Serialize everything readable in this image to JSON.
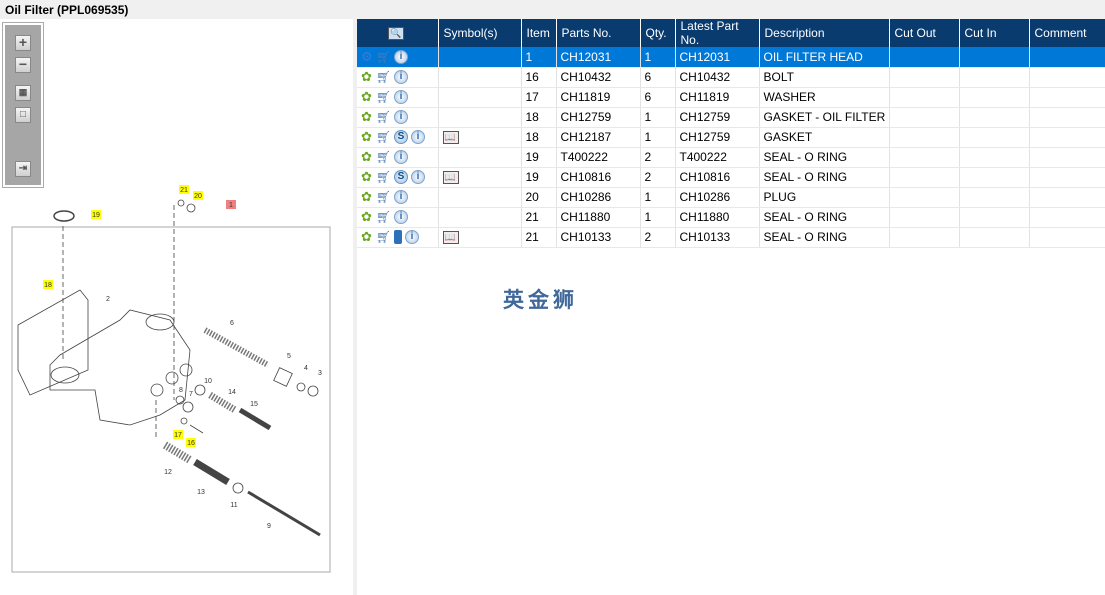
{
  "title": "Oil Filter (PPL069535)",
  "toolbar": {
    "items": [
      "zoom-in",
      "zoom-out",
      "fit-all",
      "fit-window",
      "export"
    ]
  },
  "diagram": {
    "callouts": [
      {
        "label": "21",
        "highlight": "yellow"
      },
      {
        "label": "20",
        "highlight": "yellow"
      },
      {
        "label": "1",
        "highlight": "red"
      },
      {
        "label": "19",
        "highlight": "yellow"
      },
      {
        "label": "18",
        "highlight": "yellow"
      },
      {
        "label": "2"
      },
      {
        "label": "6"
      },
      {
        "label": "5"
      },
      {
        "label": "4"
      },
      {
        "label": "3"
      },
      {
        "label": "10"
      },
      {
        "label": "8"
      },
      {
        "label": "7"
      },
      {
        "label": "14"
      },
      {
        "label": "15"
      },
      {
        "label": "17",
        "highlight": "yellow"
      },
      {
        "label": "16",
        "highlight": "yellow"
      },
      {
        "label": "12"
      },
      {
        "label": "13"
      },
      {
        "label": "11"
      },
      {
        "label": "9"
      }
    ]
  },
  "table": {
    "headers": [
      "",
      "Symbol(s)",
      "Item",
      "Parts No.",
      "Qty.",
      "Latest Part No.",
      "Description",
      "Cut Out",
      "Cut In",
      "Comment"
    ],
    "rows": [
      {
        "icons": [
          "link",
          "cart",
          "info"
        ],
        "symbol": false,
        "item": "1",
        "part": "CH12031",
        "qty": "1",
        "latest": "CH12031",
        "desc": "OIL FILTER HEAD",
        "selected": true
      },
      {
        "icons": [
          "gear",
          "cart",
          "info"
        ],
        "symbol": false,
        "item": "16",
        "part": "CH10432",
        "qty": "6",
        "latest": "CH10432",
        "desc": "BOLT"
      },
      {
        "icons": [
          "gear",
          "cart",
          "info"
        ],
        "symbol": false,
        "item": "17",
        "part": "CH11819",
        "qty": "6",
        "latest": "CH11819",
        "desc": "WASHER"
      },
      {
        "icons": [
          "gear",
          "cart",
          "info"
        ],
        "symbol": false,
        "item": "18",
        "part": "CH12759",
        "qty": "1",
        "latest": "CH12759",
        "desc": "GASKET - OIL FILTER HEA"
      },
      {
        "icons": [
          "gear",
          "cart",
          "s",
          "info"
        ],
        "symbol": true,
        "item": "18",
        "part": "CH12187",
        "qty": "1",
        "latest": "CH12759",
        "desc": "GASKET"
      },
      {
        "icons": [
          "gear",
          "cart",
          "info"
        ],
        "symbol": false,
        "item": "19",
        "part": "T400222",
        "qty": "2",
        "latest": "T400222",
        "desc": "SEAL - O RING"
      },
      {
        "icons": [
          "gear",
          "cart",
          "s",
          "info"
        ],
        "symbol": true,
        "item": "19",
        "part": "CH10816",
        "qty": "2",
        "latest": "CH10816",
        "desc": "SEAL - O RING"
      },
      {
        "icons": [
          "gear",
          "cart",
          "info"
        ],
        "symbol": false,
        "item": "20",
        "part": "CH10286",
        "qty": "1",
        "latest": "CH10286",
        "desc": "PLUG"
      },
      {
        "icons": [
          "gear",
          "cart",
          "info"
        ],
        "symbol": false,
        "item": "21",
        "part": "CH11880",
        "qty": "1",
        "latest": "CH11880",
        "desc": "SEAL - O RING"
      },
      {
        "icons": [
          "gear",
          "cart",
          "book",
          "info"
        ],
        "symbol": true,
        "item": "21",
        "part": "CH10133",
        "qty": "2",
        "latest": "CH10133",
        "desc": "SEAL - O RING"
      }
    ]
  },
  "watermark": "英金狮",
  "colors": {
    "header": "#0a3b6e",
    "selected": "#0078d7",
    "callout_yellow": "#ffff00",
    "callout_red": "#f08080"
  }
}
